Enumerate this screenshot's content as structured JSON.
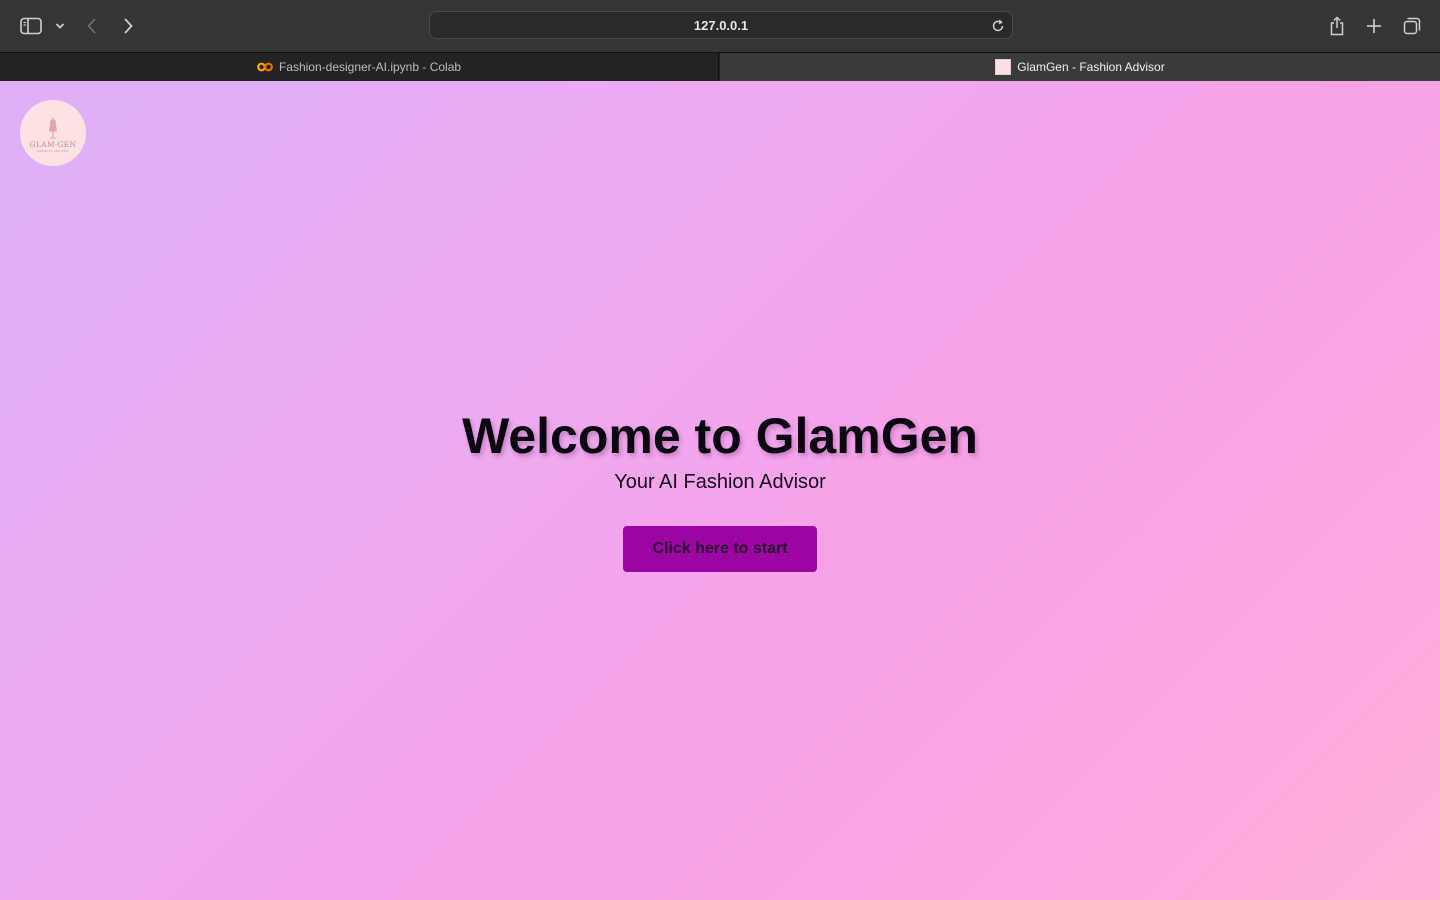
{
  "browser": {
    "address": "127.0.0.1",
    "tabs": [
      {
        "title": "Fashion-designer-AI.ipynb - Colab",
        "icon": "colab-icon",
        "active": false
      },
      {
        "title": "GlamGen - Fashion Advisor",
        "icon": "glamgen-favicon",
        "active": true
      }
    ]
  },
  "page": {
    "logo": {
      "text": "GLAM·GEN",
      "tagline": "FASHION ADVISOR"
    },
    "title": "Welcome to GlamGen",
    "subtitle": "Your AI Fashion Advisor",
    "start_button": "Click here to start"
  },
  "colors": {
    "button": "#9b05a2",
    "gradient_start": "#ddb0f8",
    "gradient_end": "#ffb2d6"
  }
}
